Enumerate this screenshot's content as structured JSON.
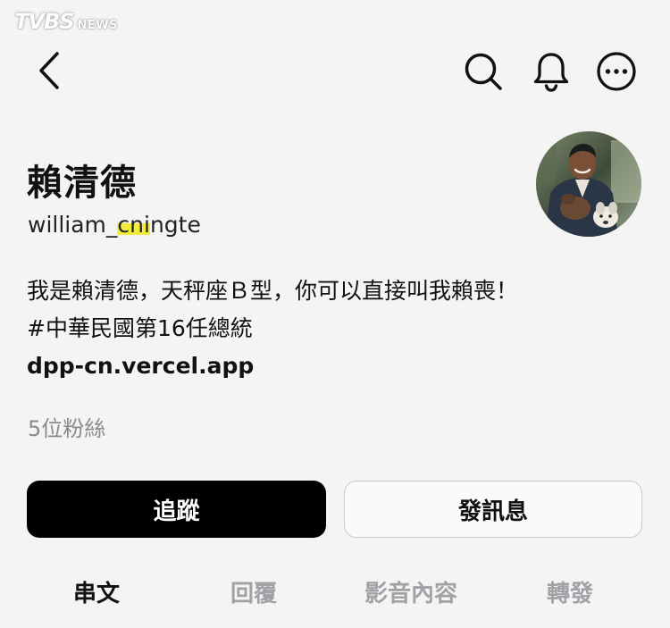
{
  "watermark": {
    "main": "TVBS",
    "sub": "NEWS"
  },
  "header": {
    "icons": [
      "back-icon",
      "search-icon",
      "bell-icon",
      "more-icon"
    ]
  },
  "profile": {
    "display_name": "賴清德",
    "username_prefix": "william_",
    "username_highlight": "cni",
    "username_suffix": "ngte",
    "bio_lines": [
      "我是賴清德，天秤座Ｂ型，你可以直接叫我賴喪！",
      "#中華民國第16任總統"
    ],
    "link": "dpp-cn.vercel.app",
    "followers": "5位粉絲"
  },
  "actions": {
    "follow_label": "追蹤",
    "message_label": "發訊息"
  },
  "tabs": [
    {
      "label": "串文",
      "active": true
    },
    {
      "label": "回覆",
      "active": false
    },
    {
      "label": "影音內容",
      "active": false
    },
    {
      "label": "轉發",
      "active": false
    }
  ],
  "colors": {
    "background": "#f4f4f5",
    "primary_button": "#000000",
    "secondary_button_border": "#c9c9cd",
    "muted_text": "#8a8a8e",
    "highlight": "#f2ec3a"
  }
}
